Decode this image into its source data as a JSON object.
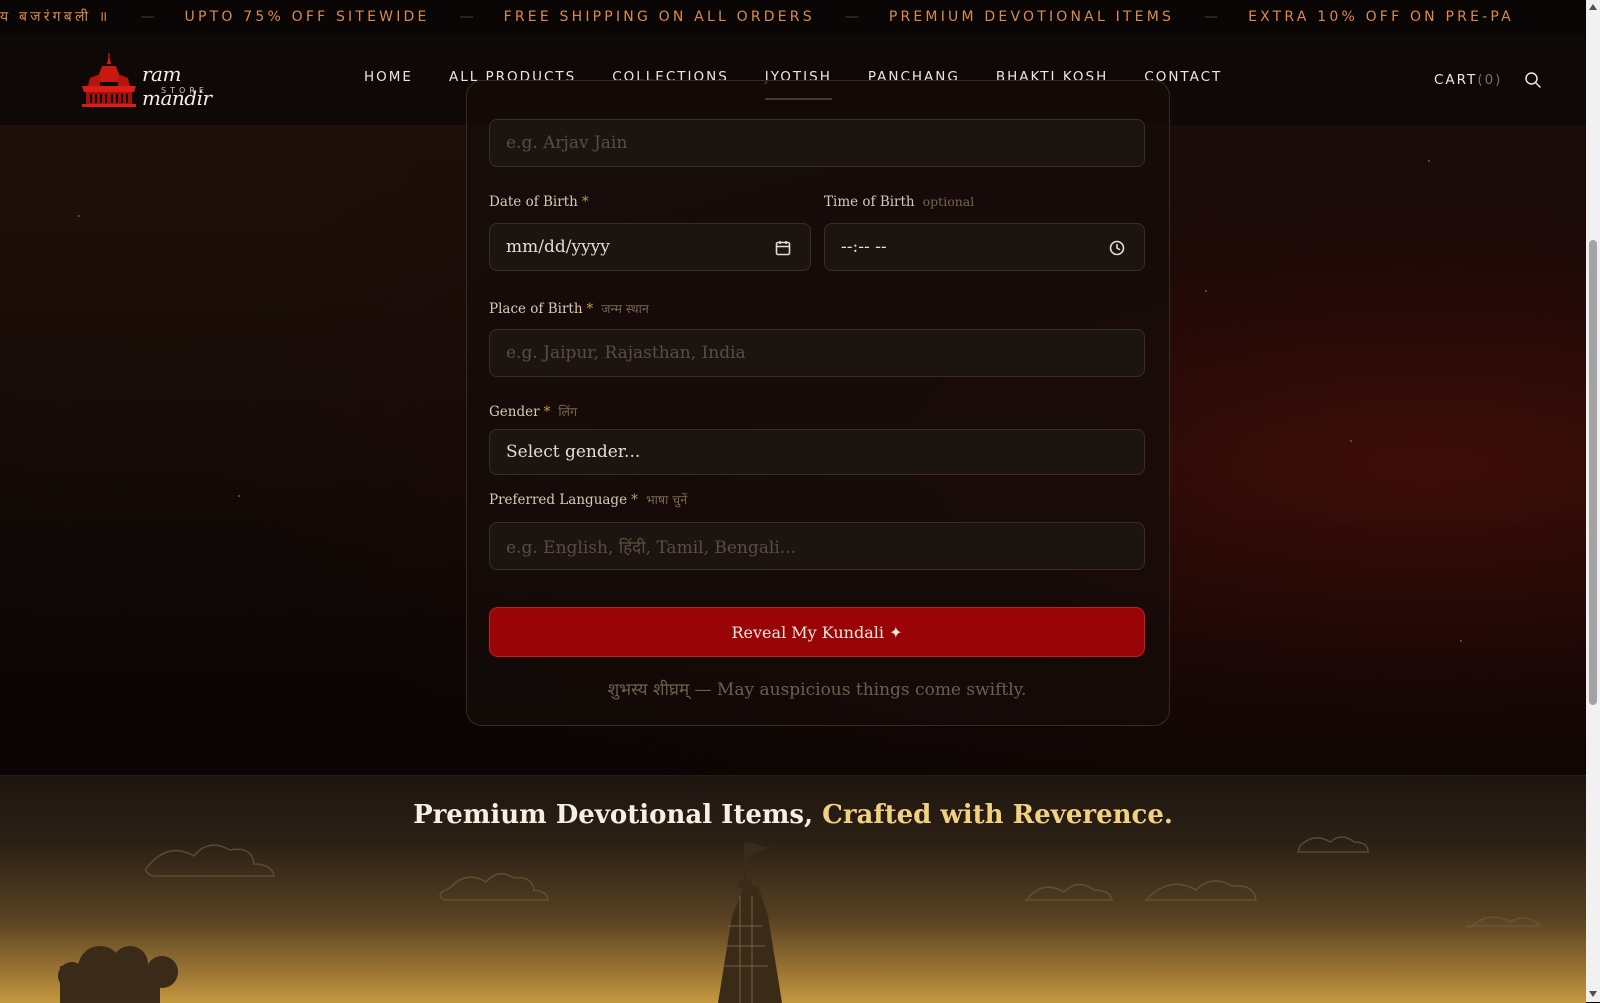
{
  "marquee": {
    "items": [
      "य बजरंगबली ॥",
      "UPTO 75% OFF SITEWIDE",
      "FREE SHIPPING ON ALL ORDERS",
      "PREMIUM DEVOTIONAL ITEMS",
      "EXTRA 10% OFF ON PRE-PA"
    ],
    "separator": "—"
  },
  "header": {
    "logo": {
      "name": "ram mandir",
      "sub": "STORE"
    },
    "nav": [
      "HOME",
      "ALL PRODUCTS",
      "COLLECTIONS",
      "JYOTISH",
      "PANCHANG",
      "BHAKTI KOSH",
      "CONTACT"
    ],
    "active_nav": "JYOTISH",
    "cart_label": "CART",
    "cart_count": "(0)"
  },
  "form": {
    "name_placeholder": "e.g. Arjav Jain",
    "dob": {
      "label": "Date of Birth",
      "required": "*",
      "value": "mm/dd/yyyy",
      "icon": "calendar-icon"
    },
    "tob": {
      "label": "Time of Birth",
      "hint": "optional",
      "value": "--:-- --",
      "icon": "clock-icon"
    },
    "pob": {
      "label": "Place of Birth",
      "required": "*",
      "hint": "जन्म स्थान",
      "placeholder": "e.g. Jaipur, Rajasthan, India"
    },
    "gender": {
      "label": "Gender",
      "required": "*",
      "hint": "लिंग",
      "selected": "Select gender..."
    },
    "language": {
      "label": "Preferred Language",
      "required": "*",
      "hint": "भाषा चुनें",
      "placeholder": "e.g. English, हिंदी, Tamil, Bengali..."
    },
    "submit_label": "Reveal My Kundali ✦",
    "blessing": "शुभस्य शीघ्रम् — May auspicious things come swiftly."
  },
  "banner": {
    "title_a": "Premium Devotional Items,",
    "title_b": "Crafted with Reverence."
  },
  "colors": {
    "accent_red": "#990506",
    "gold": "#f1d080",
    "marquee_text": "#d88a4e"
  }
}
